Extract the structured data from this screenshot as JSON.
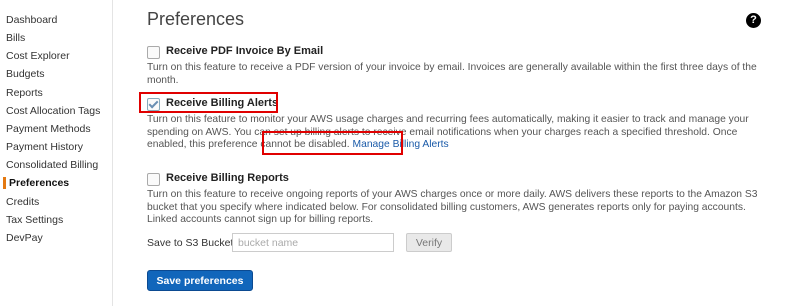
{
  "sidebar": {
    "items": [
      {
        "label": "Dashboard"
      },
      {
        "label": "Bills"
      },
      {
        "label": "Cost Explorer"
      },
      {
        "label": "Budgets"
      },
      {
        "label": "Reports"
      },
      {
        "label": "Cost Allocation Tags"
      },
      {
        "label": "Payment Methods"
      },
      {
        "label": "Payment History"
      },
      {
        "label": "Consolidated Billing"
      },
      {
        "label": "Preferences",
        "active": true
      },
      {
        "label": "Credits"
      },
      {
        "label": "Tax Settings"
      },
      {
        "label": "DevPay"
      }
    ]
  },
  "main": {
    "title": "Preferences",
    "help_icon": "question-circle-icon",
    "prefs": {
      "pdf": {
        "label": "Receive PDF Invoice By Email",
        "checked": false,
        "desc": "Turn on this feature to receive a PDF version of your invoice by email. Invoices are generally available within the first three days of the month."
      },
      "alerts": {
        "label": "Receive Billing Alerts",
        "checked": true,
        "desc": "Turn on this feature to monitor your AWS usage charges and recurring fees automatically, making it easier to track and manage your spending on AWS. You can set up billing alerts to receive email notifications when your charges reach a specified threshold. Once enabled, this preference cannot be disabled.",
        "link": "Manage Billing Alerts"
      },
      "reports": {
        "label": "Receive Billing Reports",
        "checked": false,
        "desc": "Turn on this feature to receive ongoing reports of your AWS charges once or more daily. AWS delivers these reports to the Amazon S3 bucket that you specify where indicated below. For consolidated billing customers, AWS generates reports only for paying accounts. Linked accounts cannot sign up for billing reports."
      }
    },
    "s3": {
      "label": "Save to S3 Bucket:",
      "placeholder": "bucket name",
      "value": "",
      "verify_label": "Verify"
    },
    "save_label": "Save preferences"
  },
  "colors": {
    "accent_active": "#e47911",
    "link": "#1a5aa8",
    "primary_button": "#1166bb",
    "highlight": "#e00000"
  }
}
